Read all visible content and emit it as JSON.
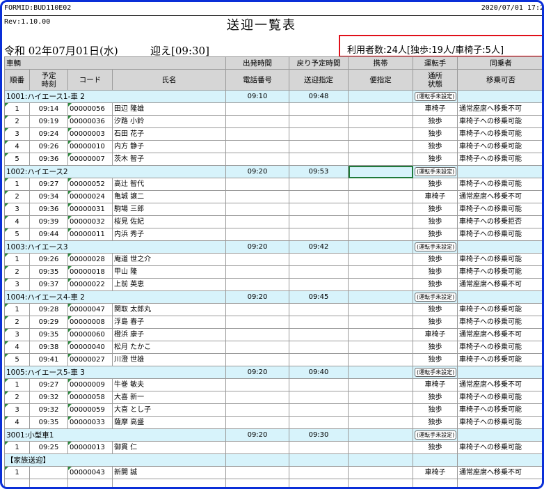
{
  "header": {
    "formid": "FORMID:BUD110E02",
    "date": "2020/07/01 17:2",
    "revision": "Rev:1.10.00",
    "title": "送迎一覧表",
    "service_date": "令和 02年07月01日(水)",
    "pickup": "迎え[09:30]",
    "users_summary": "利用者数:24人[独歩:19人/車椅子:5人]"
  },
  "columns": {
    "row1": {
      "vehicle": "車輌",
      "departure": "出発時間",
      "return_time": "戻り予定時間",
      "mobile": "携帯",
      "driver": "運転手",
      "companion": "同乗者"
    },
    "row2": {
      "order": "順番",
      "scheduled_time": "予定\n時刻",
      "code": "コード",
      "name": "氏名",
      "phone": "電話番号",
      "pickup_spec": "送迎指定",
      "convenience_spec": "便指定",
      "facility_status": "通所\n状態",
      "transfer": "移乗可否"
    }
  },
  "groups": [
    {
      "vehicle": "1001:ハイエース1-車 2",
      "departure": "09:10",
      "return": "09:48",
      "driver": "(運転手未設定)",
      "rows": [
        {
          "order": "1",
          "time": "09:14",
          "code": "00000056",
          "name": "田辺 隆雄",
          "status": "車椅子",
          "transfer": "通常座席へ移乗不可"
        },
        {
          "order": "2",
          "time": "09:19",
          "code": "00000036",
          "name": "汐路 小鈴",
          "status": "独歩",
          "transfer": "車椅子への移乗可能"
        },
        {
          "order": "3",
          "time": "09:24",
          "code": "00000003",
          "name": "石田 花子",
          "status": "独歩",
          "transfer": "車椅子への移乗可能"
        },
        {
          "order": "4",
          "time": "09:26",
          "code": "00000010",
          "name": "内方 静子",
          "status": "独歩",
          "transfer": "車椅子への移乗可能"
        },
        {
          "order": "5",
          "time": "09:36",
          "code": "00000007",
          "name": "茨木 智子",
          "status": "独歩",
          "transfer": "車椅子への移乗可能"
        }
      ]
    },
    {
      "vehicle": "1002:ハイエース2",
      "departure": "09:20",
      "return": "09:53",
      "driver": "(運転手未設定)",
      "rows": [
        {
          "order": "1",
          "time": "09:27",
          "code": "00000052",
          "name": "高辻 智代",
          "status": "独歩",
          "transfer": "車椅子への移乗可能"
        },
        {
          "order": "2",
          "time": "09:34",
          "code": "00000024",
          "name": "亀城 譲二",
          "status": "車椅子",
          "transfer": "通常座席へ移乗不可"
        },
        {
          "order": "3",
          "time": "09:36",
          "code": "00000031",
          "name": "駒場 三郎",
          "status": "独歩",
          "transfer": "車椅子への移乗可能"
        },
        {
          "order": "4",
          "time": "09:39",
          "code": "00000032",
          "name": "桜見 佐紀",
          "status": "独歩",
          "transfer": "車椅子への移乗拒否"
        },
        {
          "order": "5",
          "time": "09:44",
          "code": "00000011",
          "name": "内浜 秀子",
          "status": "独歩",
          "transfer": "車椅子への移乗可能"
        }
      ]
    },
    {
      "vehicle": "1003:ハイエース3",
      "departure": "09:20",
      "return": "09:42",
      "driver": "(運転手未設定)",
      "rows": [
        {
          "order": "1",
          "time": "09:26",
          "code": "00000028",
          "name": "庵道 世之介",
          "status": "独歩",
          "transfer": "車椅子への移乗可能"
        },
        {
          "order": "2",
          "time": "09:35",
          "code": "00000018",
          "name": "甲山 隆",
          "status": "独歩",
          "transfer": "車椅子への移乗可能"
        },
        {
          "order": "3",
          "time": "09:37",
          "code": "00000022",
          "name": "上前 英恵",
          "status": "独歩",
          "transfer": "通常座席へ移乗不可"
        }
      ]
    },
    {
      "vehicle": "1004:ハイエース4-車 2",
      "departure": "09:20",
      "return": "09:45",
      "driver": "(運転手未設定)",
      "rows": [
        {
          "order": "1",
          "time": "09:28",
          "code": "00000047",
          "name": "関取 太郎丸",
          "status": "独歩",
          "transfer": "車椅子への移乗可能"
        },
        {
          "order": "2",
          "time": "09:29",
          "code": "00000008",
          "name": "浮島 春子",
          "status": "独歩",
          "transfer": "車椅子への移乗可能"
        },
        {
          "order": "3",
          "time": "09:35",
          "code": "00000060",
          "name": "橙浜 康子",
          "status": "車椅子",
          "transfer": "通常座席へ移乗不可"
        },
        {
          "order": "4",
          "time": "09:38",
          "code": "00000040",
          "name": "松月 たかこ",
          "status": "独歩",
          "transfer": "車椅子への移乗可能"
        },
        {
          "order": "5",
          "time": "09:41",
          "code": "00000027",
          "name": "川澄 世雄",
          "status": "独歩",
          "transfer": "車椅子への移乗可能"
        }
      ]
    },
    {
      "vehicle": "1005:ハイエース5-車 3",
      "departure": "09:20",
      "return": "09:40",
      "driver": "(運転手未設定)",
      "rows": [
        {
          "order": "1",
          "time": "09:27",
          "code": "00000009",
          "name": "牛巻 敏夫",
          "status": "車椅子",
          "transfer": "通常座席へ移乗不可"
        },
        {
          "order": "2",
          "time": "09:32",
          "code": "00000058",
          "name": "大喜 新一",
          "status": "独歩",
          "transfer": "車椅子への移乗可能"
        },
        {
          "order": "3",
          "time": "09:32",
          "code": "00000059",
          "name": "大喜 とし子",
          "status": "独歩",
          "transfer": "車椅子への移乗可能"
        },
        {
          "order": "4",
          "time": "09:35",
          "code": "00000033",
          "name": "薩摩 高盛",
          "status": "独歩",
          "transfer": "車椅子への移乗可能"
        }
      ]
    },
    {
      "vehicle": "3001:小型車1",
      "departure": "09:20",
      "return": "09:30",
      "driver": "(運転手未設定)",
      "rows": [
        {
          "order": "1",
          "time": "09:25",
          "code": "00000013",
          "name": "御貫 仁",
          "status": "独歩",
          "transfer": "車椅子への移乗可能"
        }
      ]
    },
    {
      "vehicle": "【家族送迎】",
      "departure": "",
      "return": "",
      "driver": "",
      "rows": [
        {
          "order": "1",
          "time": "",
          "code": "00000043",
          "name": "新開 誠",
          "status": "車椅子",
          "transfer": "通常座席へ移乗不可"
        }
      ]
    }
  ],
  "extra_empty_rows": 1
}
